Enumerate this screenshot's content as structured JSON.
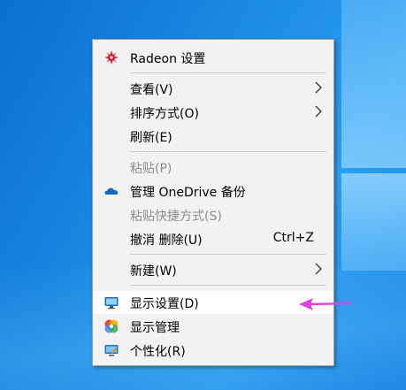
{
  "menu": {
    "items": [
      {
        "label": "Radeon 设置",
        "icon": "radeon-icon"
      },
      {
        "label": "查看(V)",
        "submenu": true
      },
      {
        "label": "排序方式(O)",
        "submenu": true
      },
      {
        "label": "刷新(E)"
      },
      {
        "label": "粘贴(P)",
        "disabled": true
      },
      {
        "label": "管理 OneDrive 备份",
        "icon": "onedrive-cloud-icon"
      },
      {
        "label": "粘贴快捷方式(S)",
        "disabled": true
      },
      {
        "label": "撤消 删除(U)",
        "accelerator": "Ctrl+Z"
      },
      {
        "label": "新建(W)",
        "submenu": true
      },
      {
        "label": "显示设置(D)",
        "icon": "display-settings-icon",
        "highlighted": true
      },
      {
        "label": "显示管理",
        "icon": "display-management-icon"
      },
      {
        "label": "个性化(R)",
        "icon": "personalize-icon"
      }
    ]
  },
  "colors": {
    "annotation_arrow": "#e040e6",
    "menu_background": "#f2f2f2",
    "disabled_text": "#8d8d8d",
    "desktop_blue": "#1787e0"
  }
}
